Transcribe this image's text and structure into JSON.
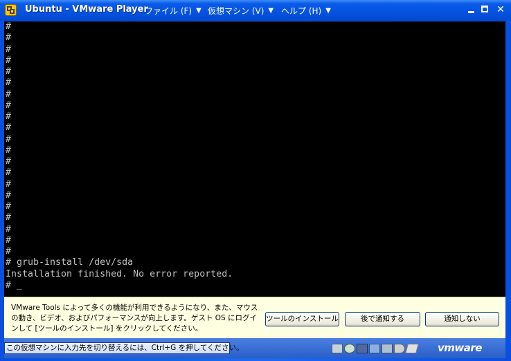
{
  "window": {
    "title": "Ubuntu - VMware Player",
    "menus": [
      {
        "label": "ファイル (F)"
      },
      {
        "label": "仮想マシン (V)"
      },
      {
        "label": "ヘルプ (H)"
      }
    ],
    "menu_arrow": "▼",
    "controls": {
      "close": "✕"
    }
  },
  "console": {
    "text": "#\n#\n#\n#\n#\n#\n#\n#\n#\n#\n#\n#\n#\n#\n#\n#\n#\n#\n#\n#\n#\n# grub-install /dev/sda\nInstallation finished. No error reported.\n# _"
  },
  "notification": {
    "message": "VMware Tools によって多くの機能が利用できるようになり、また、マウスの動き、ビデオ、およびパフォーマンスが向上します。ゲスト OS にログインして [ツールのインストール] をクリックしてください。",
    "buttons": {
      "install": "ツールのインストール",
      "later": "後で通知する",
      "never": "通知しない"
    }
  },
  "statusbar": {
    "hint": "この仮想マシンに入力先を切り替えるには、Ctrl+G を押してください。",
    "devices": [
      "hard-disk-icon",
      "cd-rom-icon",
      "floppy-icon",
      "network-icon",
      "usb-icon",
      "sound-icon",
      "message-icon"
    ],
    "brand": "vmware"
  }
}
